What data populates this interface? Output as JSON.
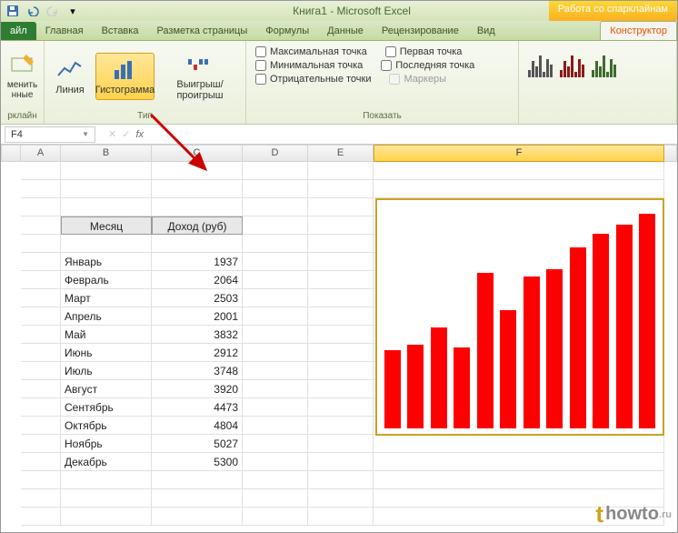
{
  "title": "Книга1 - Microsoft Excel",
  "contextual_tab": "Работа со спарклайнам",
  "tabs": {
    "file": "айл",
    "home": "Главная",
    "insert": "Вставка",
    "pagelayout": "Разметка страницы",
    "formulas": "Формулы",
    "data": "Данные",
    "review": "Рецензирование",
    "view": "Вид",
    "design": "Конструктор"
  },
  "ribbon": {
    "g1": {
      "btn1": "менить\nнные",
      "label": "рклайн"
    },
    "g2": {
      "line": "Линия",
      "column": "Гистограмма",
      "winloss": "Выигрыш/проигрыш",
      "label": "Тип"
    },
    "g3": {
      "high": "Максимальная точка",
      "first": "Первая точка",
      "low": "Минимальная точка",
      "last": "Последняя точка",
      "neg": "Отрицательные точки",
      "markers": "Маркеры",
      "label": "Показать"
    }
  },
  "namebox": "F4",
  "columns": [
    "A",
    "B",
    "C",
    "D",
    "E",
    "F"
  ],
  "table": {
    "h1": "Месяц",
    "h2": "Доход (руб)",
    "rows": [
      {
        "m": "Январь",
        "v": 1937
      },
      {
        "m": "Февраль",
        "v": 2064
      },
      {
        "m": "Март",
        "v": 2503
      },
      {
        "m": "Апрель",
        "v": 2001
      },
      {
        "m": "Май",
        "v": 3832
      },
      {
        "m": "Июнь",
        "v": 2912
      },
      {
        "m": "Июль",
        "v": 3748
      },
      {
        "m": "Август",
        "v": 3920
      },
      {
        "m": "Сентябрь",
        "v": 4473
      },
      {
        "m": "Октябрь",
        "v": 4804
      },
      {
        "m": "Ноябрь",
        "v": 5027
      },
      {
        "m": "Декабрь",
        "v": 5300
      }
    ]
  },
  "chart_data": {
    "type": "bar",
    "categories": [
      "Январь",
      "Февраль",
      "Март",
      "Апрель",
      "Май",
      "Июнь",
      "Июль",
      "Август",
      "Сентябрь",
      "Октябрь",
      "Ноябрь",
      "Декабрь"
    ],
    "values": [
      1937,
      2064,
      2503,
      2001,
      3832,
      2912,
      3748,
      3920,
      4473,
      4804,
      5027,
      5300
    ],
    "ylim": [
      0,
      5500
    ]
  },
  "watermark": "howto",
  "watermark_suffix": ".ru"
}
